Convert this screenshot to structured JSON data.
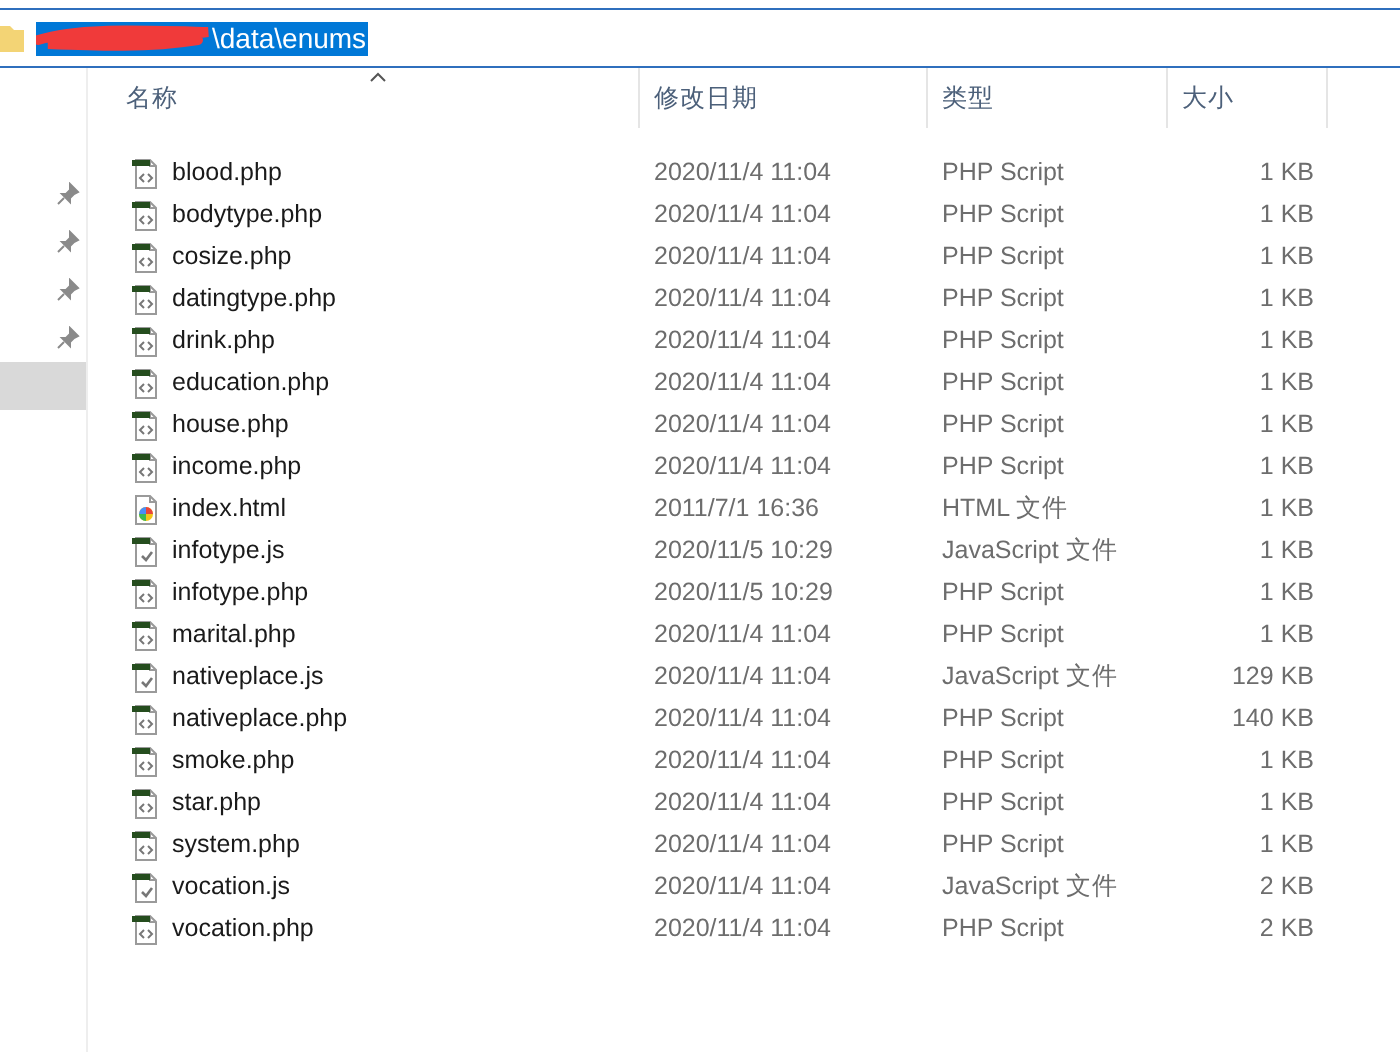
{
  "address_bar": {
    "path": "\\data\\enums",
    "selected": true,
    "redacted": true
  },
  "navigation_pane": {
    "items": [
      {
        "pinned": true,
        "selected": false
      },
      {
        "pinned": true,
        "selected": false
      },
      {
        "pinned": true,
        "selected": false
      },
      {
        "pinned": true,
        "selected": false
      },
      {
        "pinned": false,
        "selected": true
      }
    ]
  },
  "file_list": {
    "columns": [
      {
        "label": "名称",
        "sorted": true
      },
      {
        "label": "修改日期",
        "sorted": false
      },
      {
        "label": "类型",
        "sorted": false
      },
      {
        "label": "大小",
        "sorted": false
      }
    ],
    "rows": [
      {
        "name": "blood.php",
        "kind": "php",
        "modified": "2020/11/4 11:04",
        "type": "PHP Script",
        "size": "1 KB"
      },
      {
        "name": "bodytype.php",
        "kind": "php",
        "modified": "2020/11/4 11:04",
        "type": "PHP Script",
        "size": "1 KB"
      },
      {
        "name": "cosize.php",
        "kind": "php",
        "modified": "2020/11/4 11:04",
        "type": "PHP Script",
        "size": "1 KB"
      },
      {
        "name": "datingtype.php",
        "kind": "php",
        "modified": "2020/11/4 11:04",
        "type": "PHP Script",
        "size": "1 KB"
      },
      {
        "name": "drink.php",
        "kind": "php",
        "modified": "2020/11/4 11:04",
        "type": "PHP Script",
        "size": "1 KB"
      },
      {
        "name": "education.php",
        "kind": "php",
        "modified": "2020/11/4 11:04",
        "type": "PHP Script",
        "size": "1 KB"
      },
      {
        "name": "house.php",
        "kind": "php",
        "modified": "2020/11/4 11:04",
        "type": "PHP Script",
        "size": "1 KB"
      },
      {
        "name": "income.php",
        "kind": "php",
        "modified": "2020/11/4 11:04",
        "type": "PHP Script",
        "size": "1 KB"
      },
      {
        "name": "index.html",
        "kind": "html",
        "modified": "2011/7/1 16:36",
        "type": "HTML 文件",
        "size": "1 KB"
      },
      {
        "name": "infotype.js",
        "kind": "js",
        "modified": "2020/11/5 10:29",
        "type": "JavaScript 文件",
        "size": "1 KB"
      },
      {
        "name": "infotype.php",
        "kind": "php",
        "modified": "2020/11/5 10:29",
        "type": "PHP Script",
        "size": "1 KB"
      },
      {
        "name": "marital.php",
        "kind": "php",
        "modified": "2020/11/4 11:04",
        "type": "PHP Script",
        "size": "1 KB"
      },
      {
        "name": "nativeplace.js",
        "kind": "js",
        "modified": "2020/11/4 11:04",
        "type": "JavaScript 文件",
        "size": "129 KB"
      },
      {
        "name": "nativeplace.php",
        "kind": "php",
        "modified": "2020/11/4 11:04",
        "type": "PHP Script",
        "size": "140 KB"
      },
      {
        "name": "smoke.php",
        "kind": "php",
        "modified": "2020/11/4 11:04",
        "type": "PHP Script",
        "size": "1 KB"
      },
      {
        "name": "star.php",
        "kind": "php",
        "modified": "2020/11/4 11:04",
        "type": "PHP Script",
        "size": "1 KB"
      },
      {
        "name": "system.php",
        "kind": "php",
        "modified": "2020/11/4 11:04",
        "type": "PHP Script",
        "size": "1 KB"
      },
      {
        "name": "vocation.js",
        "kind": "js",
        "modified": "2020/11/4 11:04",
        "type": "JavaScript 文件",
        "size": "2 KB"
      },
      {
        "name": "vocation.php",
        "kind": "php",
        "modified": "2020/11/4 11:04",
        "type": "PHP Script",
        "size": "2 KB"
      }
    ]
  }
}
